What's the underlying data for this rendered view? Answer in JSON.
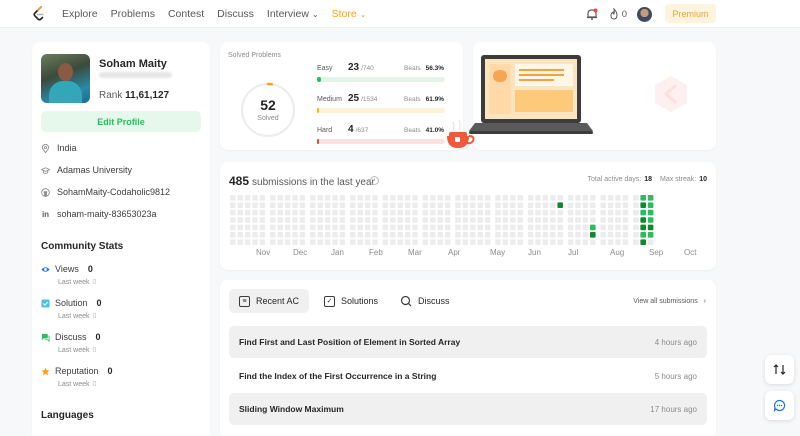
{
  "nav": {
    "items": [
      "Explore",
      "Problems",
      "Contest",
      "Discuss",
      "Interview",
      "Store"
    ],
    "streak": "0",
    "premium": "Premium"
  },
  "profile": {
    "name": "Soham Maity",
    "rank_label": "Rank",
    "rank_value": "11,61,127",
    "edit_label": "Edit Profile",
    "location": "India",
    "school": "Adamas University",
    "github": "SohamMaity-Codaholic9812",
    "linkedin": "soham-maity-83653023a"
  },
  "community": {
    "title": "Community Stats",
    "stats": [
      {
        "label": "Views",
        "value": "0",
        "last_week": "Last week",
        "delta": "0",
        "color": "#1a73e8",
        "icon": "eye-icon"
      },
      {
        "label": "Solution",
        "value": "0",
        "last_week": "Last week",
        "delta": "0",
        "color": "#4ec0e9",
        "icon": "solution-icon"
      },
      {
        "label": "Discuss",
        "value": "0",
        "last_week": "Last week",
        "delta": "0",
        "color": "#2cbb5d",
        "icon": "discuss-icon"
      },
      {
        "label": "Reputation",
        "value": "0",
        "last_week": "Last week",
        "delta": "0",
        "color": "#ffa116",
        "icon": "star-icon"
      }
    ]
  },
  "languages": {
    "title": "Languages"
  },
  "solved": {
    "label": "Solved Problems",
    "total": "52",
    "total_label": "Solved",
    "difficulties": [
      {
        "name": "Easy",
        "count": "23",
        "total": "/740",
        "beats_label": "Beats",
        "beats": "56.3%",
        "solved": 23,
        "of": 740,
        "color": "#2cbb5d",
        "track": "#e3f5e9"
      },
      {
        "name": "Medium",
        "count": "25",
        "total": "/1534",
        "beats_label": "Beats",
        "beats": "61.9%",
        "solved": 25,
        "of": 1534,
        "color": "#ffb800",
        "track": "#fdf1d6"
      },
      {
        "name": "Hard",
        "count": "4",
        "total": "/637",
        "beats_label": "Beats",
        "beats": "41.0%",
        "solved": 4,
        "of": 637,
        "color": "#ef4743",
        "track": "#fbe2e2"
      }
    ]
  },
  "submissions": {
    "count": "485",
    "label": "submissions in the last year",
    "active_label": "Total active days:",
    "active_days": "18",
    "streak_label": "Max streak:",
    "max_streak": "10",
    "months": [
      "Nov",
      "Dec",
      "Jan",
      "Feb",
      "Mar",
      "Apr",
      "May",
      "Jun",
      "Jul",
      "Aug",
      "Sep",
      "Oct"
    ]
  },
  "recent": {
    "tabs": [
      "Recent AC",
      "Solutions",
      "Discuss"
    ],
    "view_all": "View all submissions",
    "rows": [
      {
        "title": "Find First and Last Position of Element in Sorted Array",
        "time": "4 hours ago"
      },
      {
        "title": "Find the Index of the First Occurrence in a String",
        "time": "5 hours ago"
      },
      {
        "title": "Sliding Window Maximum",
        "time": "17 hours ago"
      }
    ]
  }
}
